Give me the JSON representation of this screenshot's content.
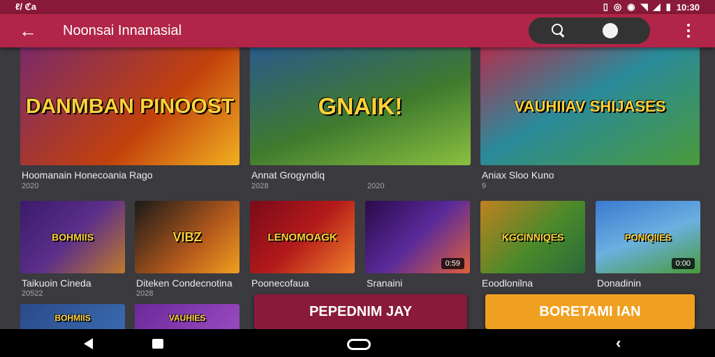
{
  "status_bar": {
    "left": "ℓ/ ℭa",
    "right": "10:30"
  },
  "app_bar": {
    "title": "Noonsai Innanasial"
  },
  "featured": [
    {
      "art": "DANMBAN PINOOST",
      "title": "Hoomanain Honecoania Rago",
      "sub": "2020",
      "sub2": "",
      "bg": "#c2410c"
    },
    {
      "art": "GNAIK!",
      "title": "Annat Grogyndiq",
      "sub": "2028",
      "sub2": "2020",
      "bg": "#3f7a2e"
    },
    {
      "art": "VAUHIIAV SHIJASES",
      "title": "Aniax Sloo Kuno",
      "sub": "9",
      "sub2": "",
      "bg": "#2a8a9a"
    }
  ],
  "games": [
    {
      "art": "BOHMIIS",
      "title": "Taikuoin Cineda",
      "sub": "20522",
      "badge": "",
      "bg": "#5b2f8a"
    },
    {
      "art": "VIBZ",
      "title": "Diteken Condecnotina",
      "sub": "2028",
      "badge": "",
      "bg": "#b3591c"
    },
    {
      "art": "LENOMOAGK",
      "title": "Poonecofaua",
      "sub": "",
      "badge": "",
      "bg": "#b31a1a"
    },
    {
      "art": "",
      "title": "Sranaini",
      "sub": "",
      "badge": "0:59",
      "bg": "#5a2a9a"
    },
    {
      "art": "KGCINNIQES",
      "title": "Eoodlonilna",
      "sub": "",
      "badge": "",
      "bg": "#4a8a2a"
    },
    {
      "art": "PONIQIIES",
      "title": "Donadinin",
      "sub": "",
      "badge": "0:00",
      "bg": "#3a7ad0"
    }
  ],
  "bottom_row": [
    {
      "art": "BOHMIIS",
      "bg": "#3a6ab0"
    },
    {
      "art": "VAUHIES",
      "bg": "#9a4ac0"
    }
  ],
  "cta": {
    "primary": "PEPEDNIM JAY",
    "secondary": "BORETAMI IAN"
  }
}
